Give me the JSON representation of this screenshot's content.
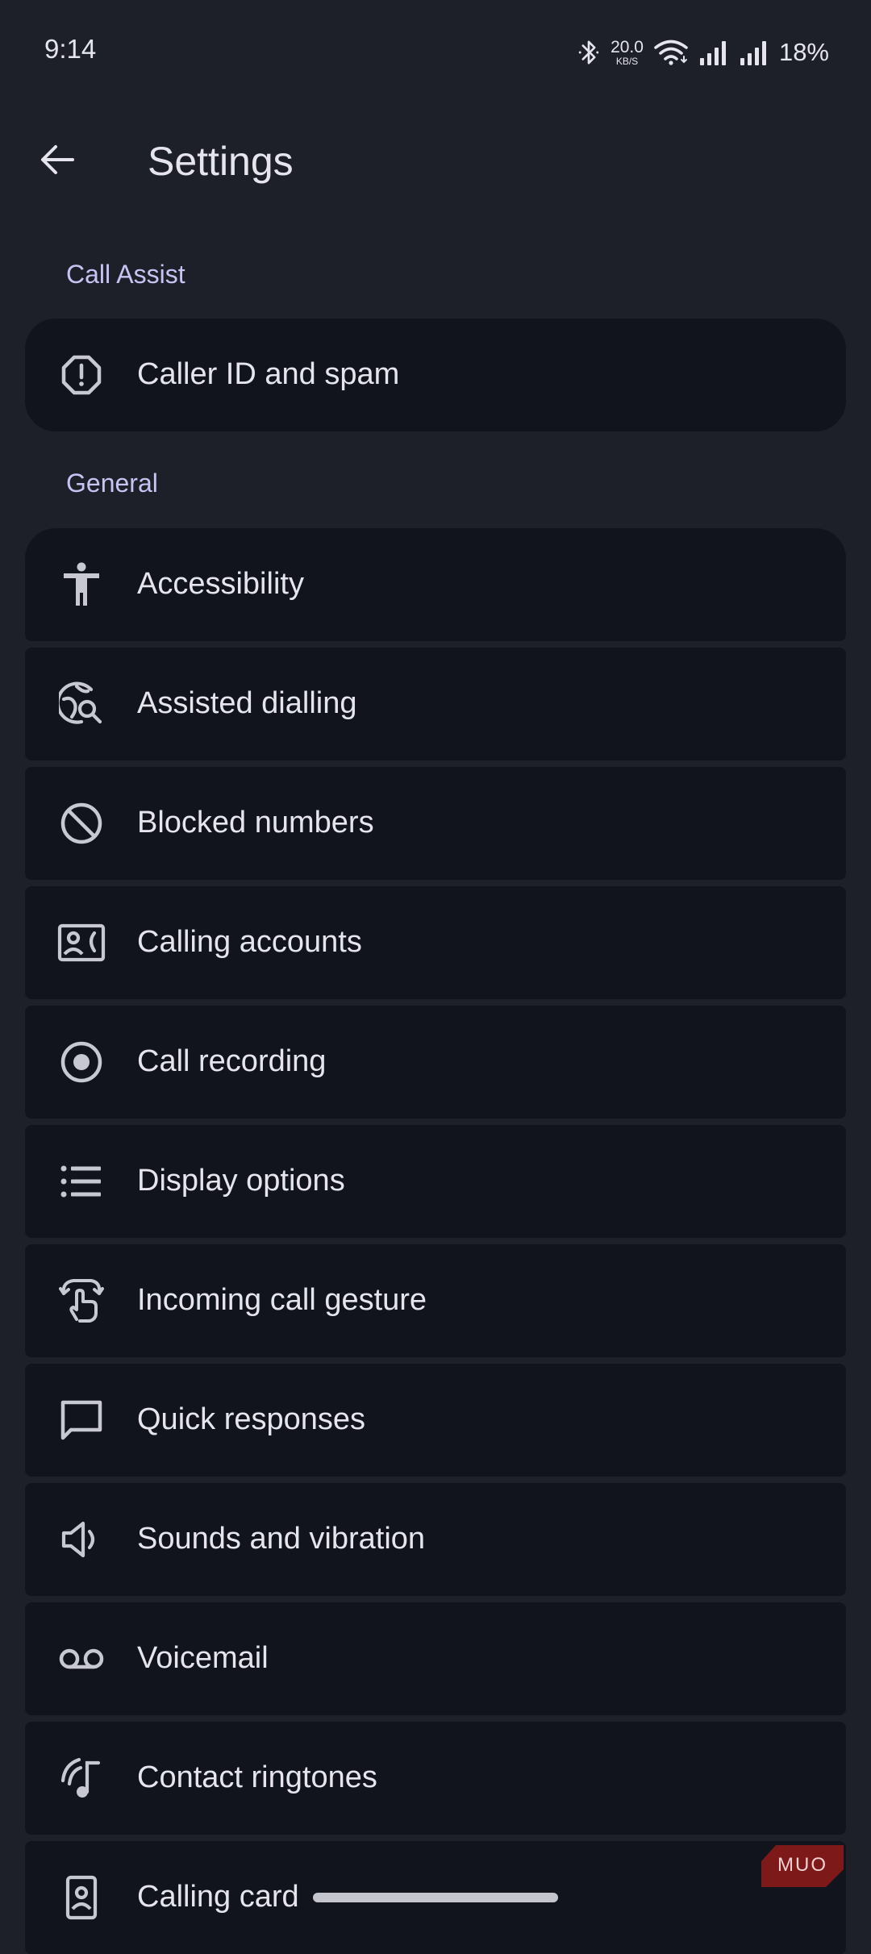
{
  "status_bar": {
    "time": "9:14",
    "net_speed_value": "20.0",
    "net_speed_unit": "KB/S",
    "battery": "18%",
    "icons": [
      "bluetooth-icon",
      "wifi-icon",
      "signal-icon",
      "signal-icon"
    ]
  },
  "app_bar": {
    "title": "Settings",
    "back_icon": "arrow-left-icon"
  },
  "sections": {
    "call_assist": {
      "header": "Call Assist",
      "items": [
        {
          "label": "Caller ID and spam",
          "icon": "spam-octagon-icon"
        }
      ]
    },
    "general": {
      "header": "General",
      "items": [
        {
          "label": "Accessibility",
          "icon": "accessibility-icon"
        },
        {
          "label": "Assisted dialling",
          "icon": "globe-search-icon"
        },
        {
          "label": "Blocked numbers",
          "icon": "block-icon"
        },
        {
          "label": "Calling accounts",
          "icon": "contact-phone-icon"
        },
        {
          "label": "Call recording",
          "icon": "record-icon"
        },
        {
          "label": "Display options",
          "icon": "list-icon"
        },
        {
          "label": "Incoming call gesture",
          "icon": "swipe-gesture-icon"
        },
        {
          "label": "Quick responses",
          "icon": "chat-bubble-icon"
        },
        {
          "label": "Sounds and vibration",
          "icon": "speaker-icon"
        },
        {
          "label": "Voicemail",
          "icon": "voicemail-icon"
        },
        {
          "label": "Contact ringtones",
          "icon": "ringtone-icon"
        },
        {
          "label": "Calling card",
          "icon": "calling-card-icon"
        }
      ]
    }
  },
  "watermark": "MUO",
  "colors": {
    "background": "#1e2029",
    "card": "#11141c",
    "section_header": "#c7c3f3",
    "text": "#e6e5ee",
    "icon": "#c7c8d2",
    "watermark": "#8b1a1a"
  }
}
